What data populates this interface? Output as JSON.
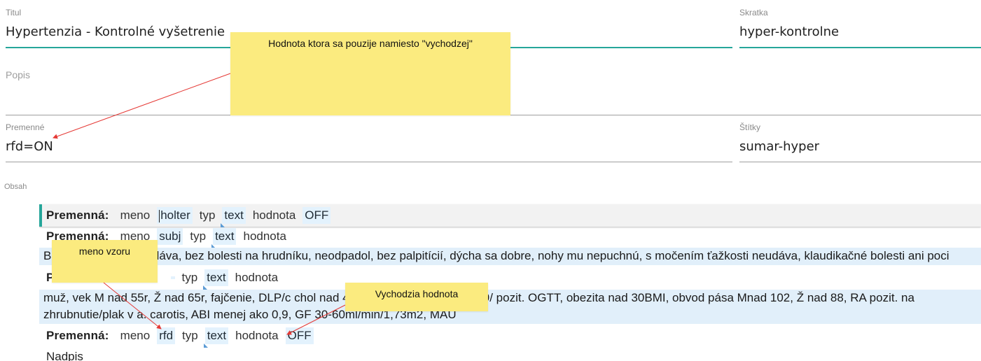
{
  "form": {
    "titul": {
      "label": "Titul",
      "value": "Hypertenzia - Kontrolné vyšetrenie"
    },
    "skratka": {
      "label": "Skratka",
      "value": "hyper-kontrolne"
    },
    "popis": {
      "label": "Popis",
      "value": ""
    },
    "premenne": {
      "label": "Premenné",
      "value": "rfd=ON"
    },
    "stitky": {
      "label": "Štítky",
      "value": "sumar-hyper"
    },
    "obsah": {
      "label": "Obsah"
    }
  },
  "editor": {
    "keyword": "Premenná:",
    "field_meno": "meno",
    "field_typ": "typ",
    "field_hodnota": "hodnota",
    "rows": [
      {
        "meno": "holter",
        "typ": "text",
        "hodnota": "OFF"
      },
      {
        "meno": "subj",
        "typ": "text",
        "hodnota": ""
      },
      {
        "meno": "",
        "typ": "text",
        "hodnota": ""
      },
      {
        "meno": "rfd",
        "typ": "text",
        "hodnota": "OFF"
      }
    ],
    "text_subj": "Bo                        oruchy zraku neudáva, bez bolesti na hrudníku, neodpadol, bez palpitícií, dýcha sa dobre, nohy mu nepuchnú, s močením ťažkosti neudáva, klaudikačné bolesti ani poci",
    "text_rf_line1": "muž, vek M nad 55r, Ž nad 65r, fajčenie, DLP/c chol nad 4,9, L                                                   nad 1,7/, glyk. 5,6-6,9/ pozit. OGTT, obezita nad 30BMI, obvod pása Mnad 102, Ž nad 88, RA pozit. na",
    "text_rf_line2": "zhrubnutie/plak v a. carotis, ABI menej ako 0,9, GF 30-60ml/min/1,73m2, MAU",
    "nadpis": "Nadpis"
  },
  "notes": {
    "note1": "Hodnota ktora sa pouzije namiesto \"vychodzej\"",
    "note2": "meno vzoru",
    "note3": "Vychodzia hodnota"
  },
  "colors": {
    "accent": "#26a69a",
    "note_bg": "#fbeb7f",
    "chip_bg": "#e3f2fd",
    "arrow": "#e53935"
  }
}
